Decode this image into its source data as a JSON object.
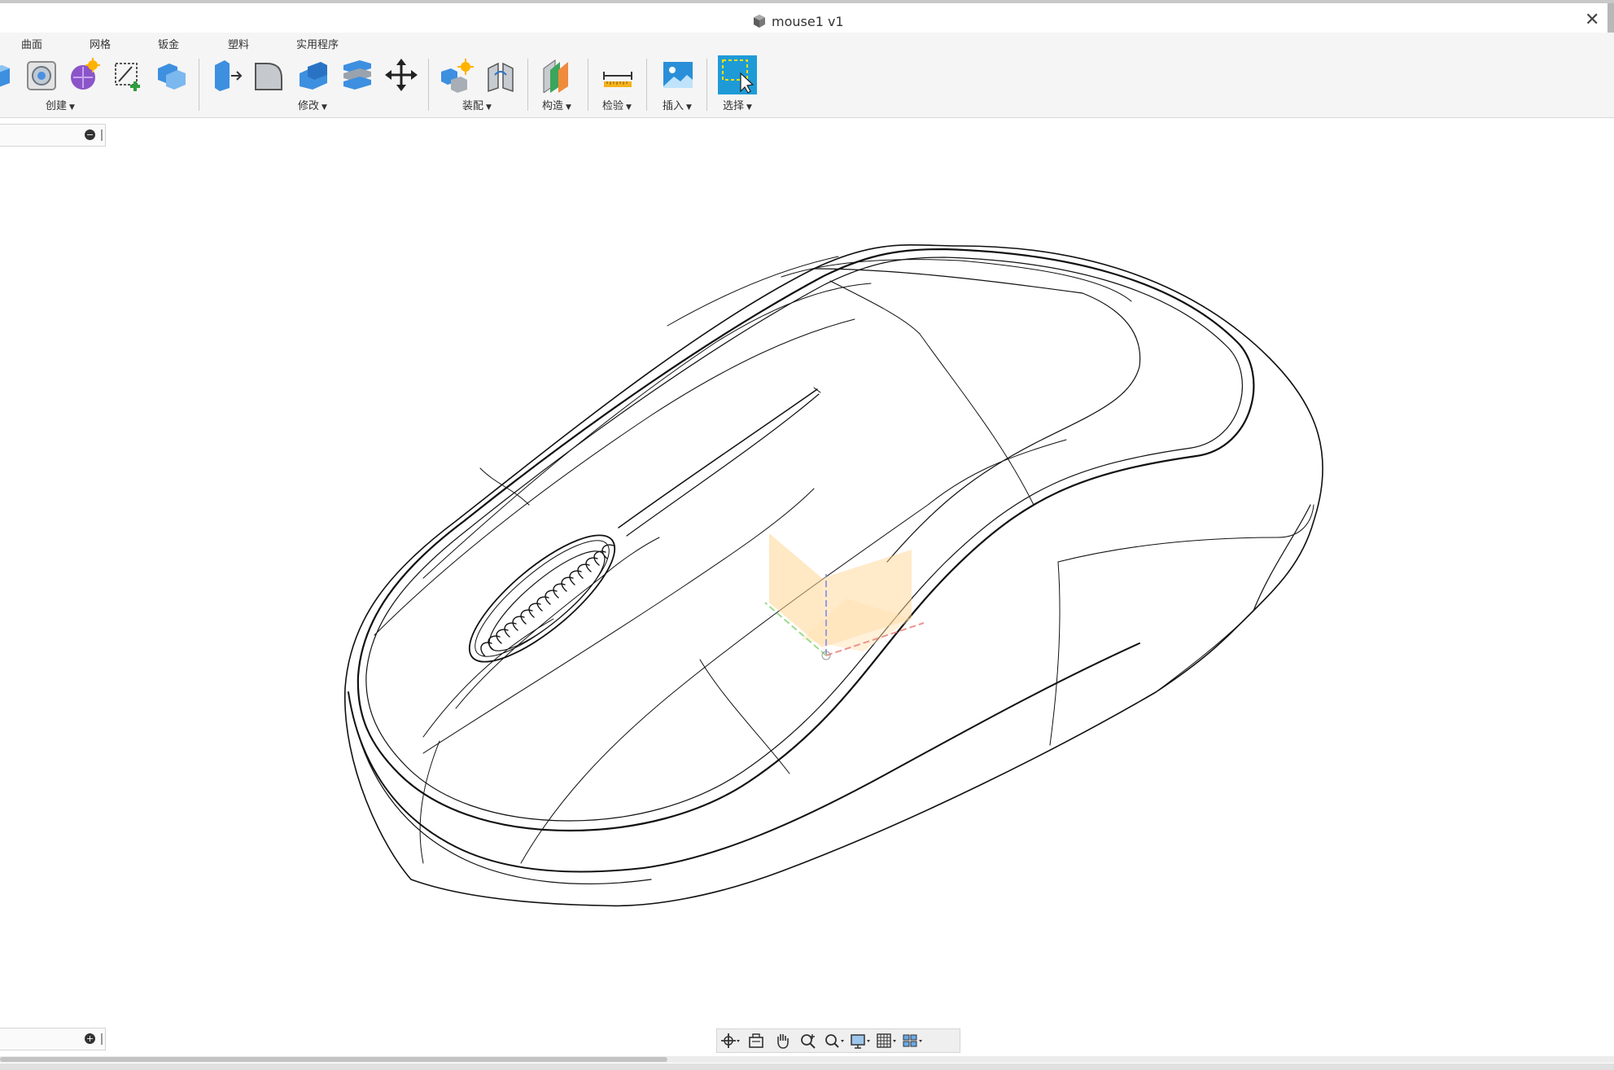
{
  "window": {
    "title": "mouse1 v1",
    "close_label": "✕"
  },
  "ribbon": {
    "tabs": [
      {
        "label": "曲面"
      },
      {
        "label": "网格"
      },
      {
        "label": "钣金"
      },
      {
        "label": "塑料"
      },
      {
        "label": "实用程序"
      }
    ],
    "groups": [
      {
        "label": "创建"
      },
      {
        "label": "修改"
      },
      {
        "label": "装配"
      },
      {
        "label": "构造"
      },
      {
        "label": "检验"
      },
      {
        "label": "插入"
      },
      {
        "label": "选择"
      }
    ],
    "accent_color": "#1e9bd7",
    "icons": [
      "extrude-icon",
      "revolve-icon",
      "form-icon",
      "sketch-icon",
      "combine-icon",
      "press-pull-icon",
      "fillet-icon",
      "shell-icon",
      "split-icon",
      "move-icon",
      "new-component-icon",
      "joint-icon",
      "offset-plane-icon",
      "measure-icon",
      "insert-image-icon",
      "window-select-icon"
    ]
  },
  "browser_panel": {
    "collapse_symbol": "−",
    "expand_symbol": "+"
  },
  "navigation_bar": {
    "tools": [
      "orbit-icon",
      "look-at-icon",
      "pan-icon",
      "zoom-icon",
      "fit-icon",
      "display-settings-icon",
      "grid-icon",
      "viewports-icon"
    ]
  },
  "viewport": {
    "model": "computer mouse wireframe",
    "origin_x_color": "#e8827a",
    "origin_y_color": "#8cd67a",
    "origin_z_color": "#8a8adb",
    "origin_plane_color": "#ffd28a"
  }
}
